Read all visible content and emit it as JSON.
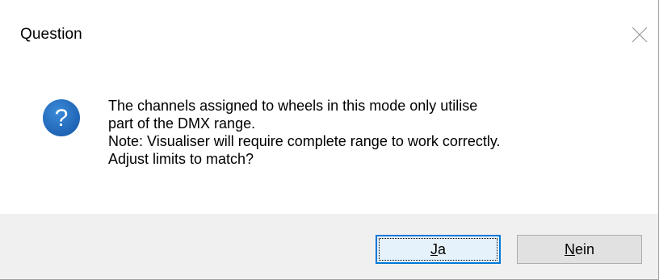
{
  "dialog": {
    "title": "Question",
    "close_icon": "close-icon",
    "icon": "question-icon",
    "message_lines": [
      "The channels assigned to wheels in this mode only utilise",
      "part of the DMX range.",
      "Note: Visualiser will require complete range to work correctly.",
      "Adjust limits to match?"
    ],
    "buttons": {
      "yes": {
        "accel": "J",
        "rest": "a"
      },
      "no": {
        "accel": "N",
        "rest": "ein"
      }
    }
  },
  "colors": {
    "accent": "#0078d7",
    "icon_blue": "#1c5fb0",
    "footer_bg": "#f0f0f0"
  }
}
